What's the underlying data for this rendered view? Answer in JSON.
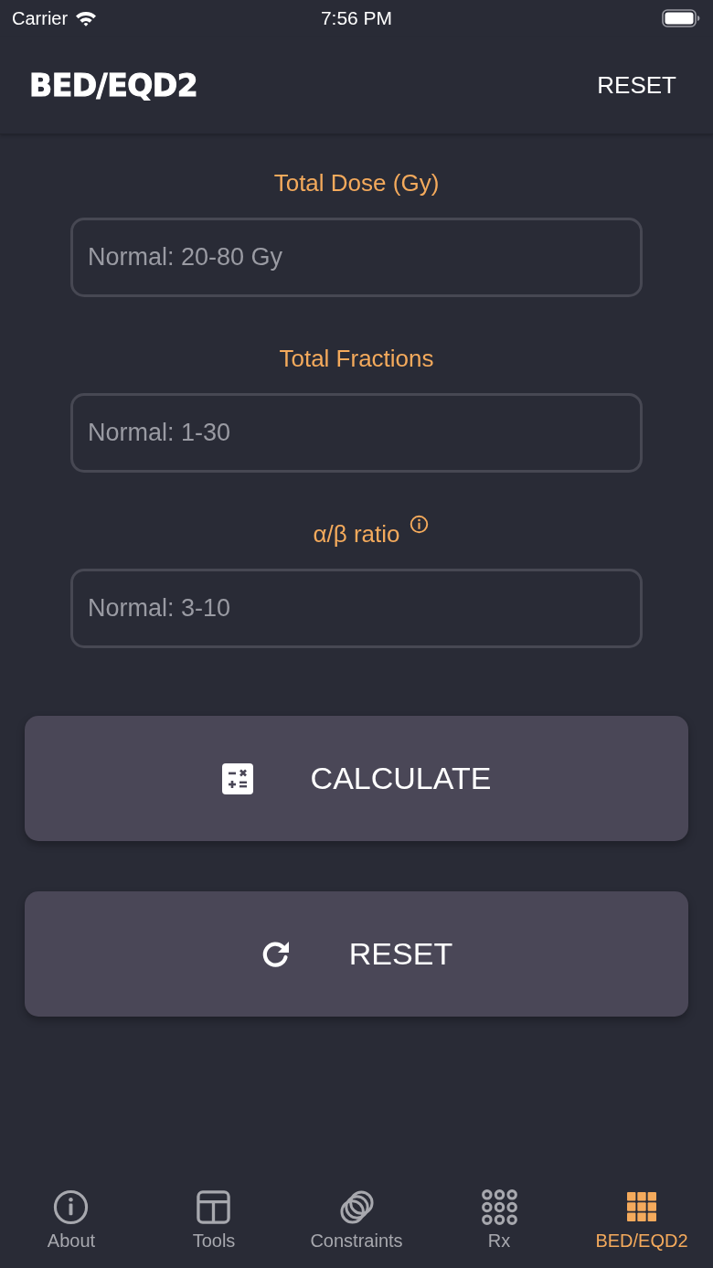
{
  "status_bar": {
    "carrier": "Carrier",
    "time": "7:56 PM"
  },
  "header": {
    "title": "BED/EQD2",
    "action": "RESET"
  },
  "fields": [
    {
      "label": "Total Dose (Gy)",
      "placeholder": "Normal: 20-80 Gy",
      "info": false
    },
    {
      "label": "Total Fractions",
      "placeholder": "Normal: 1-30",
      "info": false
    },
    {
      "label": "α/β ratio",
      "placeholder": "Normal: 3-10",
      "info": true
    }
  ],
  "buttons": [
    {
      "label": "CALCULATE",
      "kind": "calculate"
    },
    {
      "label": "RESET",
      "kind": "reset"
    }
  ],
  "tab_bar": [
    {
      "label": "About",
      "kind": "about",
      "selected": false
    },
    {
      "label": "Tools",
      "kind": "tools",
      "selected": false
    },
    {
      "label": "Constraints",
      "kind": "constraints",
      "selected": false
    },
    {
      "label": "Rx",
      "kind": "rx",
      "selected": false
    },
    {
      "label": "BED/EQD2",
      "kind": "bed",
      "selected": true
    }
  ]
}
